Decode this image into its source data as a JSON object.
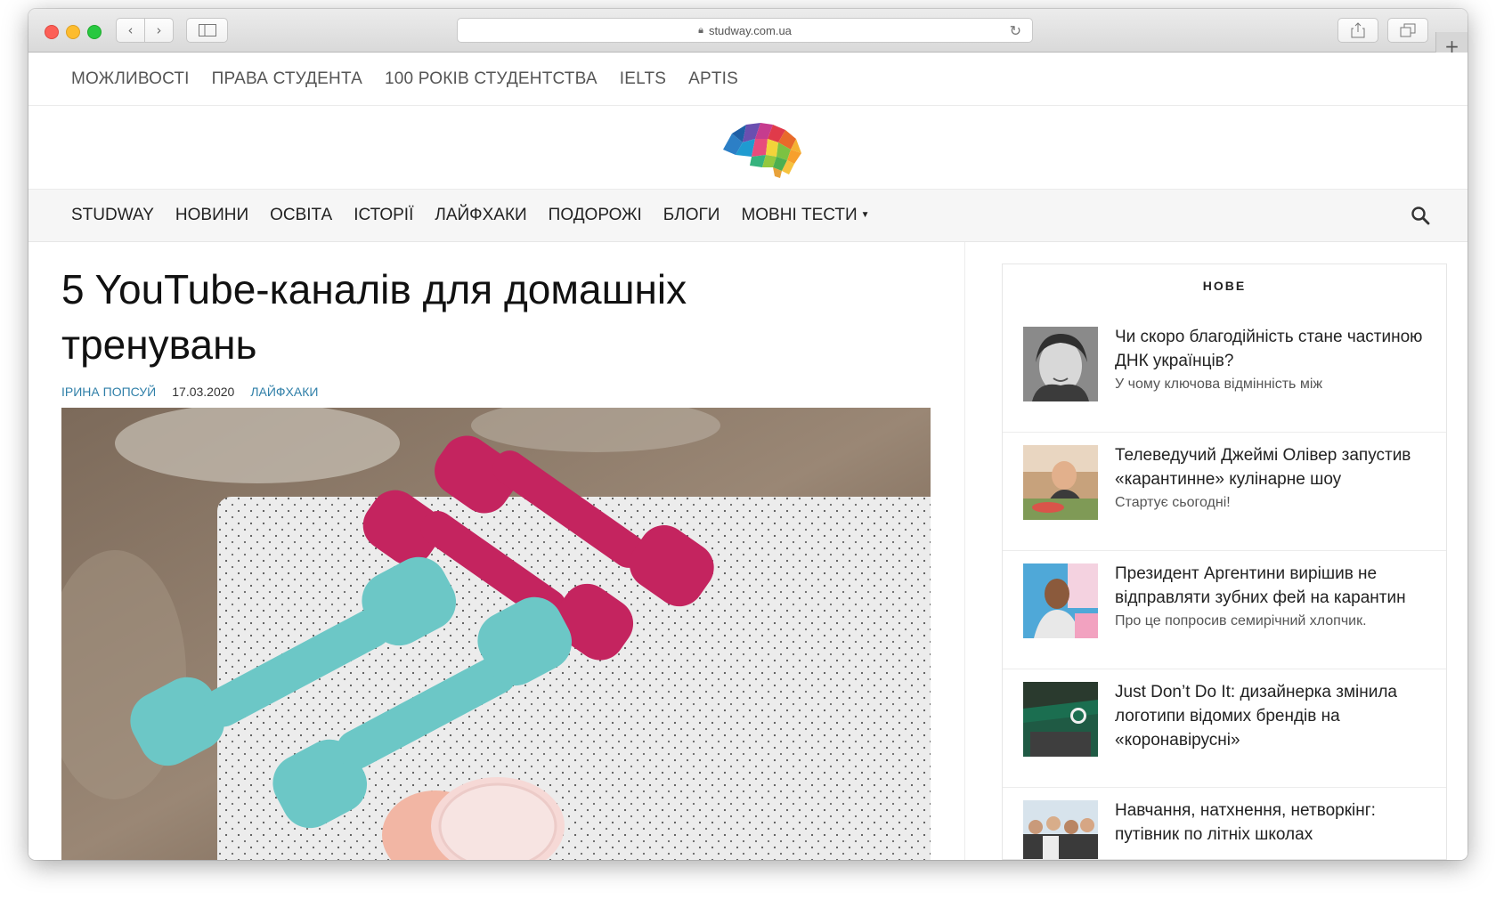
{
  "browser": {
    "url": "studway.com.ua"
  },
  "top_nav": [
    "МОЖЛИВОСТІ",
    "ПРАВА СТУДЕНТА",
    "100 РОКІВ СТУДЕНТСТВА",
    "IELTS",
    "APTIS"
  ],
  "main_nav": [
    "STUDWAY",
    "НОВИНИ",
    "ОСВІТА",
    "ІСТОРІЇ",
    "ЛАЙФХАКИ",
    "ПОДОРОЖІ",
    "БЛОГИ",
    "МОВНІ ТЕСТИ"
  ],
  "article": {
    "title": "5 YouTube-каналів для домашніх тренувань",
    "author": "ІРИНА ПОПСУЙ",
    "date": "17.03.2020",
    "category": "ЛАЙФХАКИ"
  },
  "sidebar": {
    "title": "НОВЕ",
    "posts": [
      {
        "title": "Чи скоро благодійність стане частиною ДНК українців?",
        "excerpt": "У чому ключова відмінність між"
      },
      {
        "title": "Телеведучий Джеймі Олівер запустив «карантинне» кулінарне шоу",
        "excerpt": "Стартує сьогодні!"
      },
      {
        "title": "Президент Аргентини вирішив не відправляти зубних фей на карантин",
        "excerpt": "Про це попросив семирічний хлопчик."
      },
      {
        "title": "Just Don’t Do It: дизайнерка змінила логотипи відомих брендів на «коронавірусні»",
        "excerpt": ""
      },
      {
        "title": "Навчання, натхнення, нетворкінг: путівник по літніх школах",
        "excerpt": ""
      }
    ]
  },
  "colors": {
    "link_blue": "#2f7fa8",
    "mainnav_bg": "#f6f6f6"
  }
}
